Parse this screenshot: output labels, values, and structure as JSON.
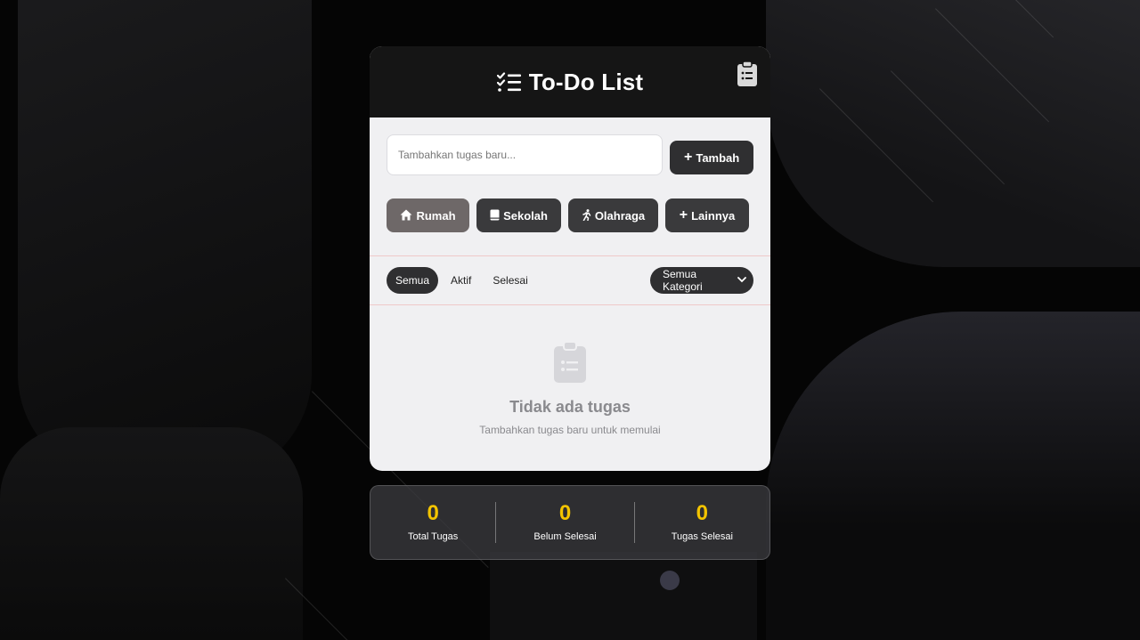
{
  "app": {
    "title": "To-Do List"
  },
  "input": {
    "placeholder": "Tambahkan tugas baru...",
    "value": ""
  },
  "add_button": {
    "icon": "plus-icon",
    "label": "Tambah"
  },
  "categories": [
    {
      "label": "Rumah",
      "icon": "home-icon",
      "active": true
    },
    {
      "label": "Sekolah",
      "icon": "book-icon",
      "active": false
    },
    {
      "label": "Olahraga",
      "icon": "running-icon",
      "active": false
    },
    {
      "label": "Lainnya",
      "icon": "plus-icon",
      "active": false
    }
  ],
  "filters": {
    "tabs": [
      {
        "label": "Semua",
        "active": true
      },
      {
        "label": "Aktif",
        "active": false
      },
      {
        "label": "Selesai",
        "active": false
      }
    ],
    "category_select": "Semua Kategori"
  },
  "empty_state": {
    "icon": "clipboard-list-icon",
    "title": "Tidak ada tugas",
    "subtitle": "Tambahkan tugas baru untuk memulai"
  },
  "stats": [
    {
      "value": "0",
      "label": "Total Tugas"
    },
    {
      "value": "0",
      "label": "Belum Selesai"
    },
    {
      "value": "0",
      "label": "Tugas Selesai"
    }
  ],
  "colors": {
    "accent": "#f3c400",
    "header_bg": "#151515",
    "card_bg": "#f0f0f2",
    "button_bg": "#2f2f31",
    "active_category_bg": "#6e6868"
  }
}
